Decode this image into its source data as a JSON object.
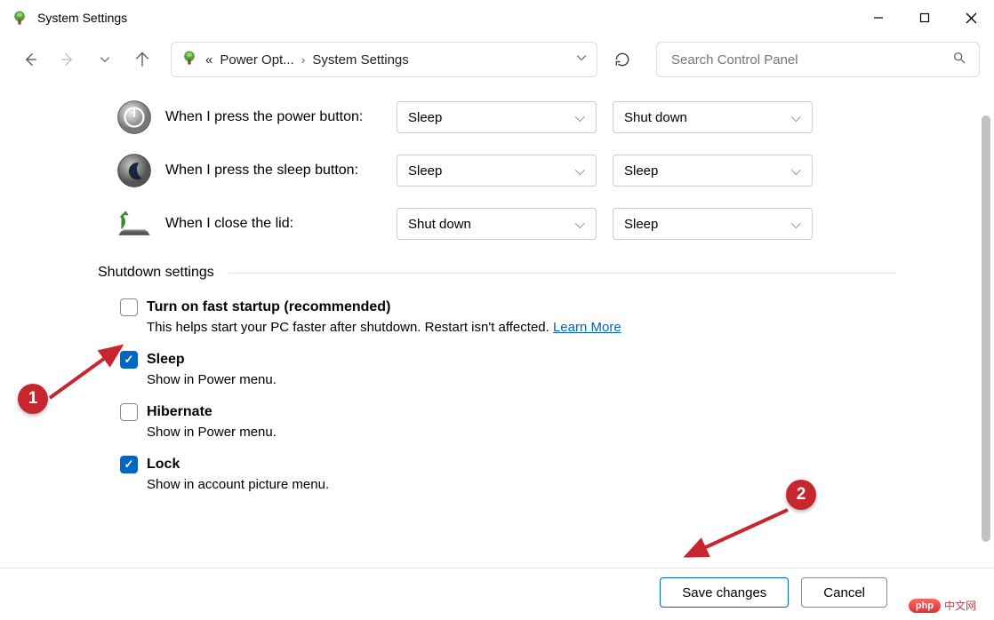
{
  "window": {
    "title": "System Settings"
  },
  "nav": {
    "breadcrumb_prefix": "«",
    "breadcrumb_1": "Power Opt...",
    "breadcrumb_2": "System Settings",
    "search_placeholder": "Search Control Panel"
  },
  "rows": {
    "power_button": {
      "label": "When I press the power button:",
      "col1": "Sleep",
      "col2": "Shut down"
    },
    "sleep_button": {
      "label": "When I press the sleep button:",
      "col1": "Sleep",
      "col2": "Sleep"
    },
    "close_lid": {
      "label": "When I close the lid:",
      "col1": "Shut down",
      "col2": "Sleep"
    }
  },
  "section": {
    "shutdown_title": "Shutdown settings"
  },
  "shutdown": {
    "fast_startup": {
      "label": "Turn on fast startup (recommended)",
      "desc_a": "This helps start your PC faster after shutdown. Restart isn't affected. ",
      "link": "Learn More",
      "checked": false
    },
    "sleep": {
      "label": "Sleep",
      "desc": "Show in Power menu.",
      "checked": true
    },
    "hibernate": {
      "label": "Hibernate",
      "desc": "Show in Power menu.",
      "checked": false
    },
    "lock": {
      "label": "Lock",
      "desc": "Show in account picture menu.",
      "checked": true
    }
  },
  "footer": {
    "save": "Save changes",
    "cancel": "Cancel"
  },
  "callouts": {
    "one": "1",
    "two": "2"
  },
  "watermark": {
    "badge": "php",
    "text": "中文网"
  }
}
